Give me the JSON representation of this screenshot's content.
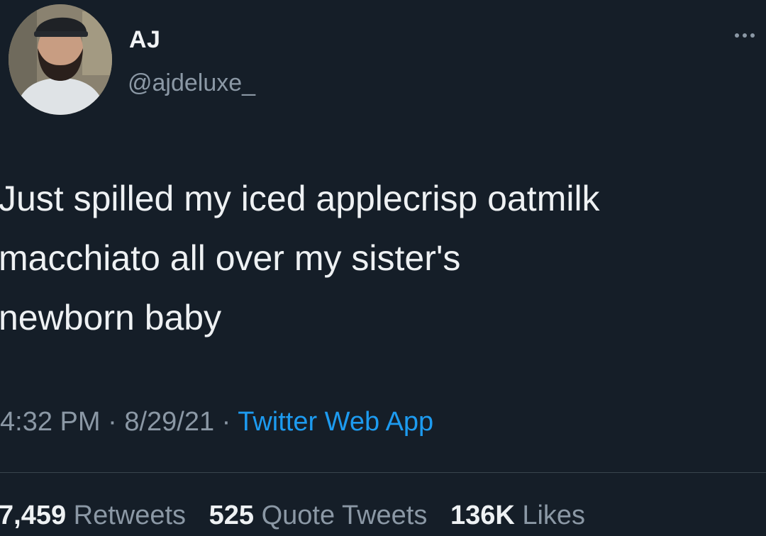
{
  "author": {
    "name": "AJ",
    "handle": "@ajdeluxe_"
  },
  "tweet": {
    "lines": [
      "Just spilled my iced applecrisp oatmilk",
      "macchiato all over my sister's",
      "newborn baby"
    ]
  },
  "meta": {
    "time": "4:32 PM",
    "separator": "·",
    "date": "8/29/21",
    "source": "Twitter Web App"
  },
  "stats": {
    "retweets_count": "7,459",
    "retweets_label": "Retweets",
    "quotes_count": "525",
    "quotes_label": "Quote Tweets",
    "likes_count": "136K",
    "likes_label": "Likes"
  },
  "icons": {
    "more": "more-options-icon",
    "avatar": "profile-photo"
  },
  "colors": {
    "background": "#151e28",
    "text": "#eef1f3",
    "secondary": "#8b98a5",
    "link": "#1d9bf0"
  }
}
